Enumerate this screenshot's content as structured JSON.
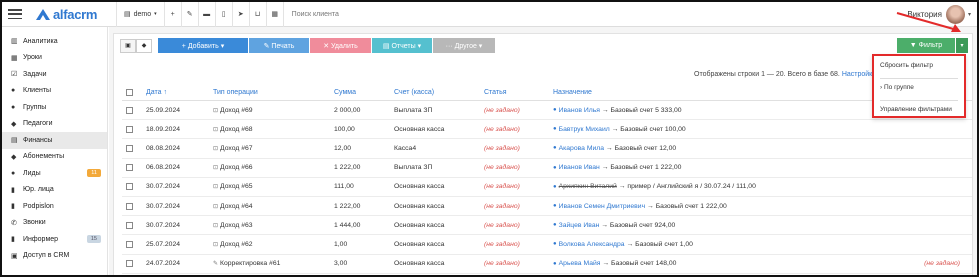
{
  "topbar": {
    "logo_text": "alfacrm",
    "branch": "demo",
    "branch_caret": "▾",
    "search_placeholder": "Поиск клиента",
    "icons": [
      "plus-icon",
      "wrench-icon",
      "card-icon",
      "phone-icon",
      "telegram-icon",
      "cart-icon",
      "calendar-icon"
    ],
    "user_name": "Виктория",
    "user_caret": "▾"
  },
  "sidebar": {
    "items": [
      {
        "label": "Аналитика",
        "icon": "chart-icon"
      },
      {
        "label": "Уроки",
        "icon": "calendar-icon"
      },
      {
        "label": "Задачи",
        "icon": "tasks-icon"
      },
      {
        "label": "Клиенты",
        "icon": "user-icon"
      },
      {
        "label": "Группы",
        "icon": "group-icon"
      },
      {
        "label": "Педагоги",
        "icon": "teacher-icon"
      },
      {
        "label": "Финансы",
        "icon": "money-icon",
        "active": true
      },
      {
        "label": "Абонементы",
        "icon": "tag-icon"
      },
      {
        "label": "Лиды",
        "icon": "lead-icon",
        "badge": "11",
        "badge_color": "#f3a93a"
      },
      {
        "label": "Юр. лица",
        "icon": "building-icon"
      },
      {
        "label": "Podpislon",
        "icon": "doc-icon"
      },
      {
        "label": "Звонки",
        "icon": "phone-icon"
      },
      {
        "label": "Информер",
        "icon": "informer-icon",
        "badge": "15",
        "badge_color": "#c9d6e2"
      },
      {
        "label": "Доступ в CRM",
        "icon": "lock-icon"
      }
    ]
  },
  "toolbar": {
    "add_label": "+ Добавить ▾",
    "print_label": "✎ Печать",
    "delete_label": "✕ Удалить",
    "reports_label": "▤ Отчеты ▾",
    "other_label": "··· Другое ▾",
    "filter_label": "▼ Фильтр",
    "filter_caret": "▾"
  },
  "info": {
    "text": "Отображены строки 1 — 20. Всего в базе 68.",
    "settings_link": "Настройка"
  },
  "table": {
    "headers": {
      "date": "Дата ↑",
      "type": "Тип операции",
      "sum": "Сумма",
      "account": "Счет (касса)",
      "article": "Статья",
      "destination": "Назначение"
    },
    "rows": [
      {
        "date": "25.09.2024",
        "type": "Доход #69",
        "sum": "2 000,00",
        "account": "Выплата ЗП",
        "article": "(не задано)",
        "person": "Иванов Илья",
        "strike": false,
        "dest": "→ Базовый счет 5 333,00",
        "extra": ""
      },
      {
        "date": "18.09.2024",
        "type": "Доход #68",
        "sum": "100,00",
        "account": "Основная касса",
        "article": "(не задано)",
        "person": "Бавтрук Михаил",
        "strike": false,
        "dest": "→ Базовый счет 100,00",
        "extra": ""
      },
      {
        "date": "08.08.2024",
        "type": "Доход #67",
        "sum": "12,00",
        "account": "Касса4",
        "article": "(не задано)",
        "person": "Акарова Мила",
        "strike": false,
        "dest": "→ Базовый счет 12,00",
        "extra": ""
      },
      {
        "date": "06.08.2024",
        "type": "Доход #66",
        "sum": "1 222,00",
        "account": "Выплата ЗП",
        "article": "(не задано)",
        "person": "Иванов Иван",
        "strike": false,
        "dest": "→ Базовый счет 1 222,00",
        "extra": ""
      },
      {
        "date": "30.07.2024",
        "type": "Доход #65",
        "sum": "111,00",
        "account": "Основная касса",
        "article": "(не задано)",
        "person": "Архипкин Виталий",
        "strike": true,
        "dest": "→ пример / Английский я / 30.07.24 / 111,00",
        "extra": ""
      },
      {
        "date": "30.07.2024",
        "type": "Доход #64",
        "sum": "1 222,00",
        "account": "Основная касса",
        "article": "(не задано)",
        "person": "Иванов Семен Дмитриевич",
        "strike": false,
        "dest": "→ Базовый счет 1 222,00",
        "extra": ""
      },
      {
        "date": "30.07.2024",
        "type": "Доход #63",
        "sum": "1 444,00",
        "account": "Основная касса",
        "article": "(не задано)",
        "person": "Зайцев Иван",
        "strike": false,
        "dest": "→ Базовый счет 924,00",
        "extra": ""
      },
      {
        "date": "25.07.2024",
        "type": "Доход #62",
        "sum": "1,00",
        "account": "Основная касса",
        "article": "(не задано)",
        "person": "Волкова Александра",
        "strike": false,
        "dest": "→ Базовый счет 1,00",
        "extra": ""
      },
      {
        "date": "24.07.2024",
        "type": "Корректировка #61",
        "sum": "3,00",
        "account": "Основная касса",
        "article": "(не задано)",
        "person": "Арьева Майя",
        "strike": false,
        "dest": "→ Базовый счет 148,00",
        "extra": "(не задано)"
      }
    ]
  },
  "filter_dropdown": {
    "items": [
      "Сбросить фильтр",
      "› По группе",
      "Управление фильтрами"
    ]
  },
  "colors": {
    "accent_blue": "#2f78d0",
    "filter_green": "#4cae6a",
    "highlight_red": "#e32a2a",
    "unset_red": "#d9534f"
  }
}
